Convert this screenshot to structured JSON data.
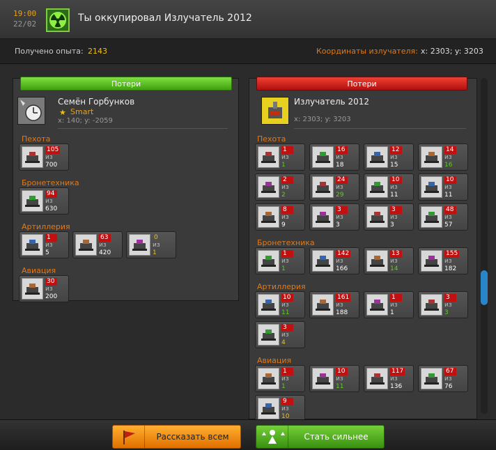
{
  "header": {
    "time": "19:00",
    "date": "22/02",
    "title": "Ты оккупировал Излучатель 2012",
    "icon": "radiation-icon"
  },
  "info": {
    "exp_label": "Получено опыта:",
    "exp_value": "2143",
    "coord_label": "Координаты излучателя:",
    "coord_value": "x: 2303; y: 3203"
  },
  "left": {
    "header": "Потери",
    "player": {
      "name": "Семён Горбунков",
      "rank": "Smart",
      "coords": "x: 140; y: -2059"
    },
    "categories": [
      {
        "name": "Пехота",
        "units": [
          {
            "lost": "105",
            "iz": "из",
            "total": "700",
            "tot_color": "w"
          }
        ]
      },
      {
        "name": "Бронетехника",
        "units": [
          {
            "lost": "94",
            "iz": "из",
            "total": "630",
            "tot_color": "w"
          }
        ]
      },
      {
        "name": "Артиллерия",
        "units": [
          {
            "lost": "1",
            "iz": "из",
            "total": "5",
            "tot_color": "w"
          },
          {
            "lost": "63",
            "iz": "из",
            "total": "420",
            "tot_color": "w"
          },
          {
            "lost": "0",
            "iz": "из",
            "total": "1",
            "tot_color": "y",
            "zero": true
          }
        ]
      },
      {
        "name": "Авиация",
        "units": [
          {
            "lost": "30",
            "iz": "из",
            "total": "200",
            "tot_color": "w"
          }
        ]
      }
    ]
  },
  "right": {
    "header": "Потери",
    "target": {
      "name": "Излучатель 2012",
      "coords": "x: 2303; y: 3203"
    },
    "categories": [
      {
        "name": "Пехота",
        "units": [
          {
            "lost": "1",
            "iz": "из",
            "total": "1",
            "tot_color": "g"
          },
          {
            "lost": "16",
            "iz": "из",
            "total": "18",
            "tot_color": "w"
          },
          {
            "lost": "12",
            "iz": "из",
            "total": "15",
            "tot_color": "w"
          },
          {
            "lost": "14",
            "iz": "из",
            "total": "16",
            "tot_color": "g"
          },
          {
            "lost": "2",
            "iz": "из",
            "total": "2",
            "tot_color": "g"
          },
          {
            "lost": "24",
            "iz": "из",
            "total": "29",
            "tot_color": "g"
          },
          {
            "lost": "10",
            "iz": "из",
            "total": "11",
            "tot_color": "w"
          },
          {
            "lost": "10",
            "iz": "из",
            "total": "11",
            "tot_color": "w"
          },
          {
            "lost": "8",
            "iz": "из",
            "total": "9",
            "tot_color": "w"
          },
          {
            "lost": "3",
            "iz": "из",
            "total": "3",
            "tot_color": "w"
          },
          {
            "lost": "3",
            "iz": "из",
            "total": "3",
            "tot_color": "w"
          },
          {
            "lost": "48",
            "iz": "из",
            "total": "57",
            "tot_color": "w"
          }
        ]
      },
      {
        "name": "Бронетехника",
        "units": [
          {
            "lost": "1",
            "iz": "из",
            "total": "1",
            "tot_color": "g"
          },
          {
            "lost": "142",
            "iz": "из",
            "total": "166",
            "tot_color": "w"
          },
          {
            "lost": "13",
            "iz": "из",
            "total": "14",
            "tot_color": "g"
          },
          {
            "lost": "155",
            "iz": "из",
            "total": "182",
            "tot_color": "w"
          }
        ]
      },
      {
        "name": "Артиллерия",
        "units": [
          {
            "lost": "10",
            "iz": "из",
            "total": "11",
            "tot_color": "g"
          },
          {
            "lost": "161",
            "iz": "из",
            "total": "188",
            "tot_color": "w"
          },
          {
            "lost": "1",
            "iz": "из",
            "total": "1",
            "tot_color": "w"
          },
          {
            "lost": "3",
            "iz": "из",
            "total": "3",
            "tot_color": "g"
          },
          {
            "lost": "3",
            "iz": "из",
            "total": "4",
            "tot_color": "y"
          }
        ]
      },
      {
        "name": "Авиация",
        "units": [
          {
            "lost": "1",
            "iz": "из",
            "total": "1",
            "tot_color": "g"
          },
          {
            "lost": "10",
            "iz": "из",
            "total": "11",
            "tot_color": "g"
          },
          {
            "lost": "117",
            "iz": "из",
            "total": "136",
            "tot_color": "w"
          },
          {
            "lost": "67",
            "iz": "из",
            "total": "76",
            "tot_color": "w"
          },
          {
            "lost": "9",
            "iz": "из",
            "total": "10",
            "tot_color": "y"
          }
        ]
      }
    ]
  },
  "buttons": {
    "tell_all": "Рассказать всем",
    "get_stronger": "Стать сильнее"
  },
  "colors": {
    "accent": "#e07a1a",
    "loss_badge": "#c01010",
    "green": "#5ed020",
    "yellow": "#e8c020"
  }
}
